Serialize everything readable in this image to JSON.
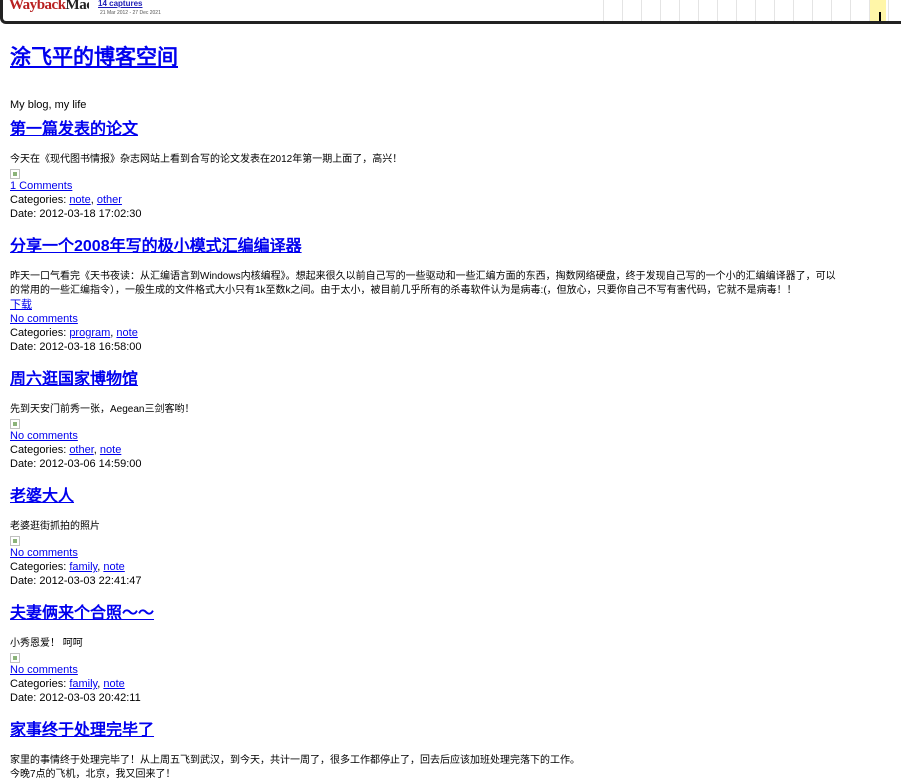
{
  "wayback": {
    "logo_way": "Way",
    "logo_back": "back",
    "logo_machine": "Machine",
    "captures": "14 captures",
    "date_range": "21 Mar 2012 - 27 Dec 2021"
  },
  "blog": {
    "title": "涂飞平的博客空间",
    "tagline": "My blog, my life"
  },
  "labels": {
    "categories": "Categories: ",
    "date": "Date: ",
    "separator": ", "
  },
  "posts": [
    {
      "title": "第一篇发表的论文",
      "excerpt": "今天在《现代图书情报》杂志网站上看到合写的论文发表在2012年第一期上面了，高兴！",
      "comments": "1 Comments",
      "categories": [
        "note",
        "other"
      ],
      "date": "2012-03-18 17:02:30"
    },
    {
      "title": "分享一个2008年写的极小模式汇编编译器",
      "excerpt": "昨天一口气看完《天书夜读：从汇编语言到Windows内核编程》。想起来很久以前自己写的一些驱动和一些汇编方面的东西，掏数网络硬盘，终于发现自己写的一个小的汇编编译器了，可以",
      "excerpt2": "的常用的一些汇编指令），一般生成的文件格式大小只有1k至数k之间。由于太小，被目前几乎所有的杀毒软件认为是病毒:(，但放心，只要你自己不写有害代码，它就不是病毒！！",
      "download": "下载",
      "comments": "No comments",
      "categories": [
        "program",
        "note"
      ],
      "date": "2012-03-18 16:58:00"
    },
    {
      "title": "周六逛国家博物馆",
      "excerpt": "先到天安门前秀一张，Aegean三剑客哟！",
      "comments": "No comments",
      "categories": [
        "other",
        "note"
      ],
      "date": "2012-03-06 14:59:00"
    },
    {
      "title": "老婆大人",
      "excerpt": "老婆逛街抓拍的照片",
      "comments": "No comments",
      "categories": [
        "family",
        "note"
      ],
      "date": "2012-03-03 22:41:47"
    },
    {
      "title": "夫妻俩来个合照～～",
      "excerpt": "小秀恩爱！ 呵呵",
      "comments": "No comments",
      "categories": [
        "family",
        "note"
      ],
      "date": "2012-03-03 20:42:11"
    },
    {
      "title": "家事终于处理完毕了",
      "excerpt": "家里的事情终于处理完毕了！从上周五飞到武汉，到今天，共计一周了，很多工作都停止了，回去后应该加班处理完落下的工作。",
      "excerpt2": "今晚7点的飞机，北京，我又回来了！"
    }
  ]
}
